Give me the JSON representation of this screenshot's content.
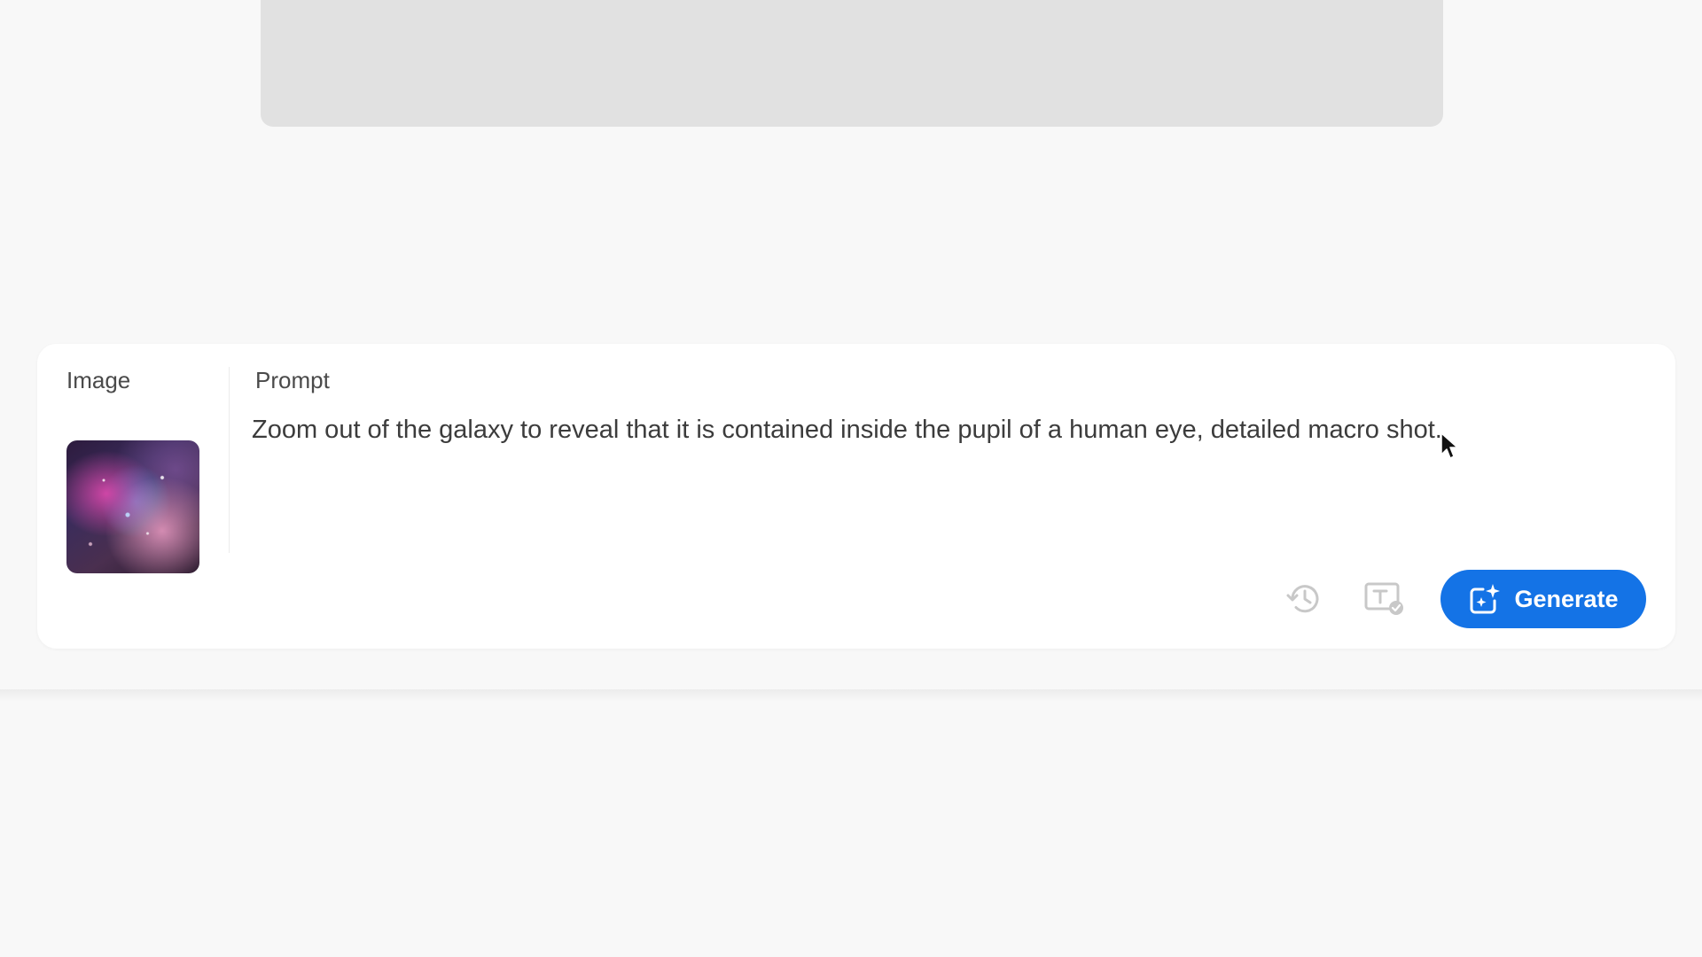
{
  "image_section": {
    "label": "Image",
    "thumbnail_icon": "galaxy-nebula-image"
  },
  "prompt_section": {
    "label": "Prompt",
    "value": "Zoom out of the galaxy to reveal that it is contained inside the pupil of a human eye, detailed macro shot."
  },
  "actions": {
    "history_icon": "history-icon",
    "content_credentials_icon": "text-check-icon",
    "generate_label": "Generate",
    "generate_icon": "sparkle-image-icon"
  },
  "colors": {
    "accent": "#1473e6",
    "background": "#f8f8f8",
    "card": "#ffffff",
    "placeholder": "#e1e1e1",
    "icon_muted": "#c8c8c8"
  }
}
